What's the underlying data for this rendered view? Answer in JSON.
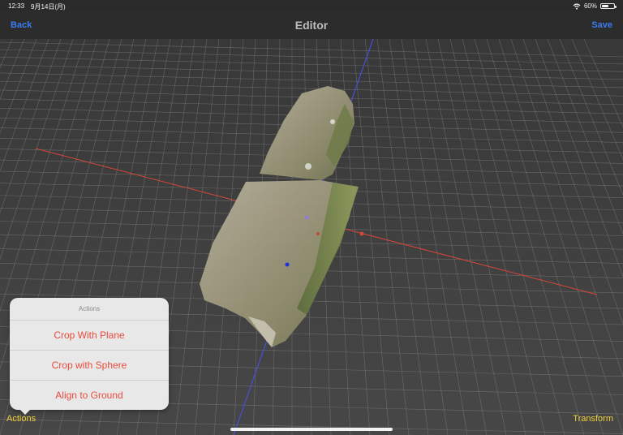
{
  "status_bar": {
    "time": "12:33",
    "date": "9月14日(月)",
    "battery": "60%",
    "battery_level": 0.6,
    "wifi_icon": "wifi-icon"
  },
  "nav": {
    "back": "Back",
    "title": "Editor",
    "save": "Save"
  },
  "popover": {
    "title": "Actions",
    "items": [
      "Crop With Plane",
      "Crop with Sphere",
      "Align to Ground"
    ]
  },
  "toolbar": {
    "actions": "Actions",
    "transform": "Transform"
  },
  "colors": {
    "link": "#3a7df2",
    "action_item": "#e94b3c",
    "toolbar_label": "#f0d13a",
    "axis_x": "#d8463a",
    "axis_y": "#4b4fd6"
  }
}
